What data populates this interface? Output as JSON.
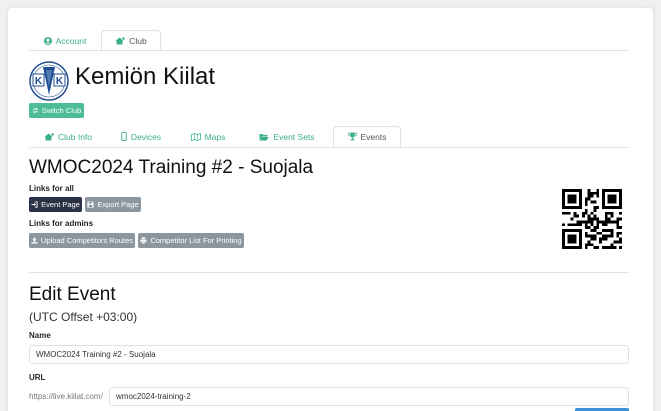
{
  "top_tabs": [
    {
      "label": "Account",
      "icon": "user-circle-icon",
      "active": false
    },
    {
      "label": "Club",
      "icon": "home-gear-icon",
      "active": true
    }
  ],
  "club": {
    "name": "Kemiön Kiilat",
    "logo_letters": [
      "K",
      "K"
    ],
    "switch_label": "Switch Club"
  },
  "sub_tabs": [
    {
      "label": "Club Info",
      "icon": "home-gear-icon",
      "active": false
    },
    {
      "label": "Devices",
      "icon": "phone-icon",
      "active": false
    },
    {
      "label": "Maps",
      "icon": "map-icon",
      "active": false
    },
    {
      "label": "Event Sets",
      "icon": "folder-open-icon",
      "active": false
    },
    {
      "label": "Events",
      "icon": "trophy-icon",
      "active": true
    }
  ],
  "event": {
    "title": "WMOC2024 Training #2 - Suojala",
    "links_for_all": "Links for all",
    "event_page": "Event Page",
    "export_page": "Export Page",
    "links_for_admins": "Links for admins",
    "upload_routes": "Upload Competitors Routes",
    "competitor_list": "Competitor List For Printing"
  },
  "edit": {
    "title": "Edit Event",
    "utc_offset": "(UTC Offset +03:00)",
    "name_label": "Name",
    "name_value": "WMOC2024 Training #2 - Suojala",
    "url_label": "URL",
    "url_prefix": "https://live.kiilat.com/",
    "url_value": "wmoc2024-training-2"
  },
  "colors": {
    "accent": "#3bae8e",
    "button_green": "#4dbc98",
    "button_dark": "#2b3245",
    "button_grey": "#8c969e",
    "logo_blue": "#1f4f93"
  }
}
